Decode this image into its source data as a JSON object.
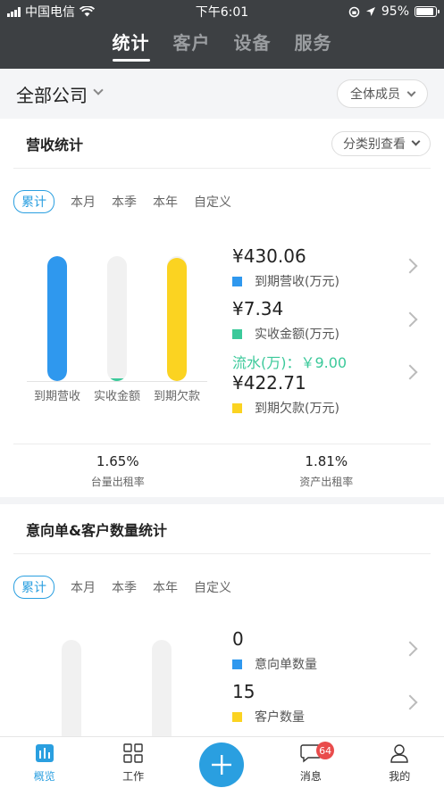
{
  "status_bar": {
    "carrier": "中国电信",
    "time": "下午6:01",
    "battery": "95%"
  },
  "header": {
    "tabs": [
      {
        "label": "统计",
        "active": true
      },
      {
        "label": "客户",
        "active": false
      },
      {
        "label": "设备",
        "active": false
      },
      {
        "label": "服务",
        "active": false
      }
    ]
  },
  "company_bar": {
    "title": "全部公司",
    "members_label": "全体成员"
  },
  "revenue_card": {
    "title": "营收统计",
    "category_label": "分类别查看",
    "periods": [
      "累计",
      "本月",
      "本季",
      "本年",
      "自定义"
    ],
    "stats": [
      {
        "value": "¥430.06",
        "label": "到期营收(万元)",
        "color": "#2f98ee"
      },
      {
        "value": "¥7.34",
        "label": "实收金额(万元)",
        "color": "#3bc99a"
      },
      {
        "value": "¥422.71",
        "label": "到期欠款(万元)",
        "color": "#fbd321"
      }
    ],
    "flow_text": "流水(万)：￥9.00",
    "rates": [
      {
        "value": "1.65%",
        "label": "台量出租率"
      },
      {
        "value": "1.81%",
        "label": "资产出租率"
      }
    ]
  },
  "intent_card": {
    "title": "意向单&客户数量统计",
    "periods": [
      "累计",
      "本月",
      "本季",
      "本年",
      "自定义"
    ],
    "stats": [
      {
        "value": "0",
        "label": "意向单数量",
        "color": "#2f98ee"
      },
      {
        "value": "15",
        "label": "客户数量",
        "color": "#fbd321"
      }
    ]
  },
  "chart_data": [
    {
      "type": "bar",
      "categories": [
        "到期营收",
        "实收金额",
        "到期欠款"
      ],
      "values": [
        430.06,
        7.34,
        422.71
      ],
      "colors": [
        "#2f98ee",
        "#3bc99a",
        "#fbd321"
      ],
      "ylim": [
        0,
        430.06
      ]
    },
    {
      "type": "bar",
      "categories": [
        "",
        ""
      ],
      "values": [
        0,
        15
      ]
    }
  ],
  "tabbar": {
    "items": [
      {
        "label": "概览",
        "icon": "chart-icon",
        "active": true
      },
      {
        "label": "工作",
        "icon": "grid-icon",
        "active": false
      },
      {
        "label": "",
        "icon": "plus-icon",
        "active": false
      },
      {
        "label": "消息",
        "icon": "message-icon",
        "badge": "64",
        "active": false
      },
      {
        "label": "我的",
        "icon": "user-icon",
        "active": false
      }
    ]
  }
}
